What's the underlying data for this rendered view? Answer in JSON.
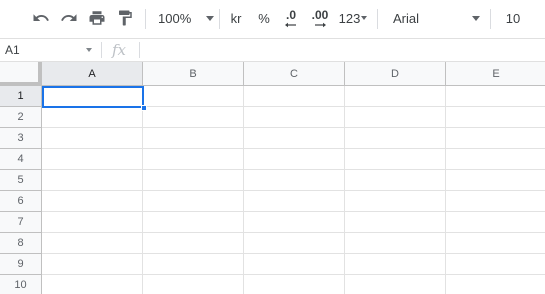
{
  "toolbar": {
    "undo_icon": "undo-icon",
    "redo_icon": "redo-icon",
    "print_icon": "print-icon",
    "paint_format_icon": "paint-format-icon",
    "zoom": "100%",
    "currency": "kr",
    "percent": "%",
    "decrease_decimal": ".0",
    "increase_decimal": ".00",
    "more_formats": "123",
    "font": "Arial",
    "font_size": "10"
  },
  "formula_bar": {
    "name_box": "A1",
    "fx_label": "fx",
    "value": ""
  },
  "grid": {
    "columns": [
      "A",
      "B",
      "C",
      "D",
      "E"
    ],
    "rows": [
      "1",
      "2",
      "3",
      "4",
      "5",
      "6",
      "7",
      "8",
      "9",
      "10"
    ],
    "selected_cell": "A1"
  },
  "colors": {
    "selection": "#1a73e8",
    "header_bg": "#f8f9fa",
    "active_header_bg": "#e8eaed",
    "gridline": "#e2e2e2"
  }
}
